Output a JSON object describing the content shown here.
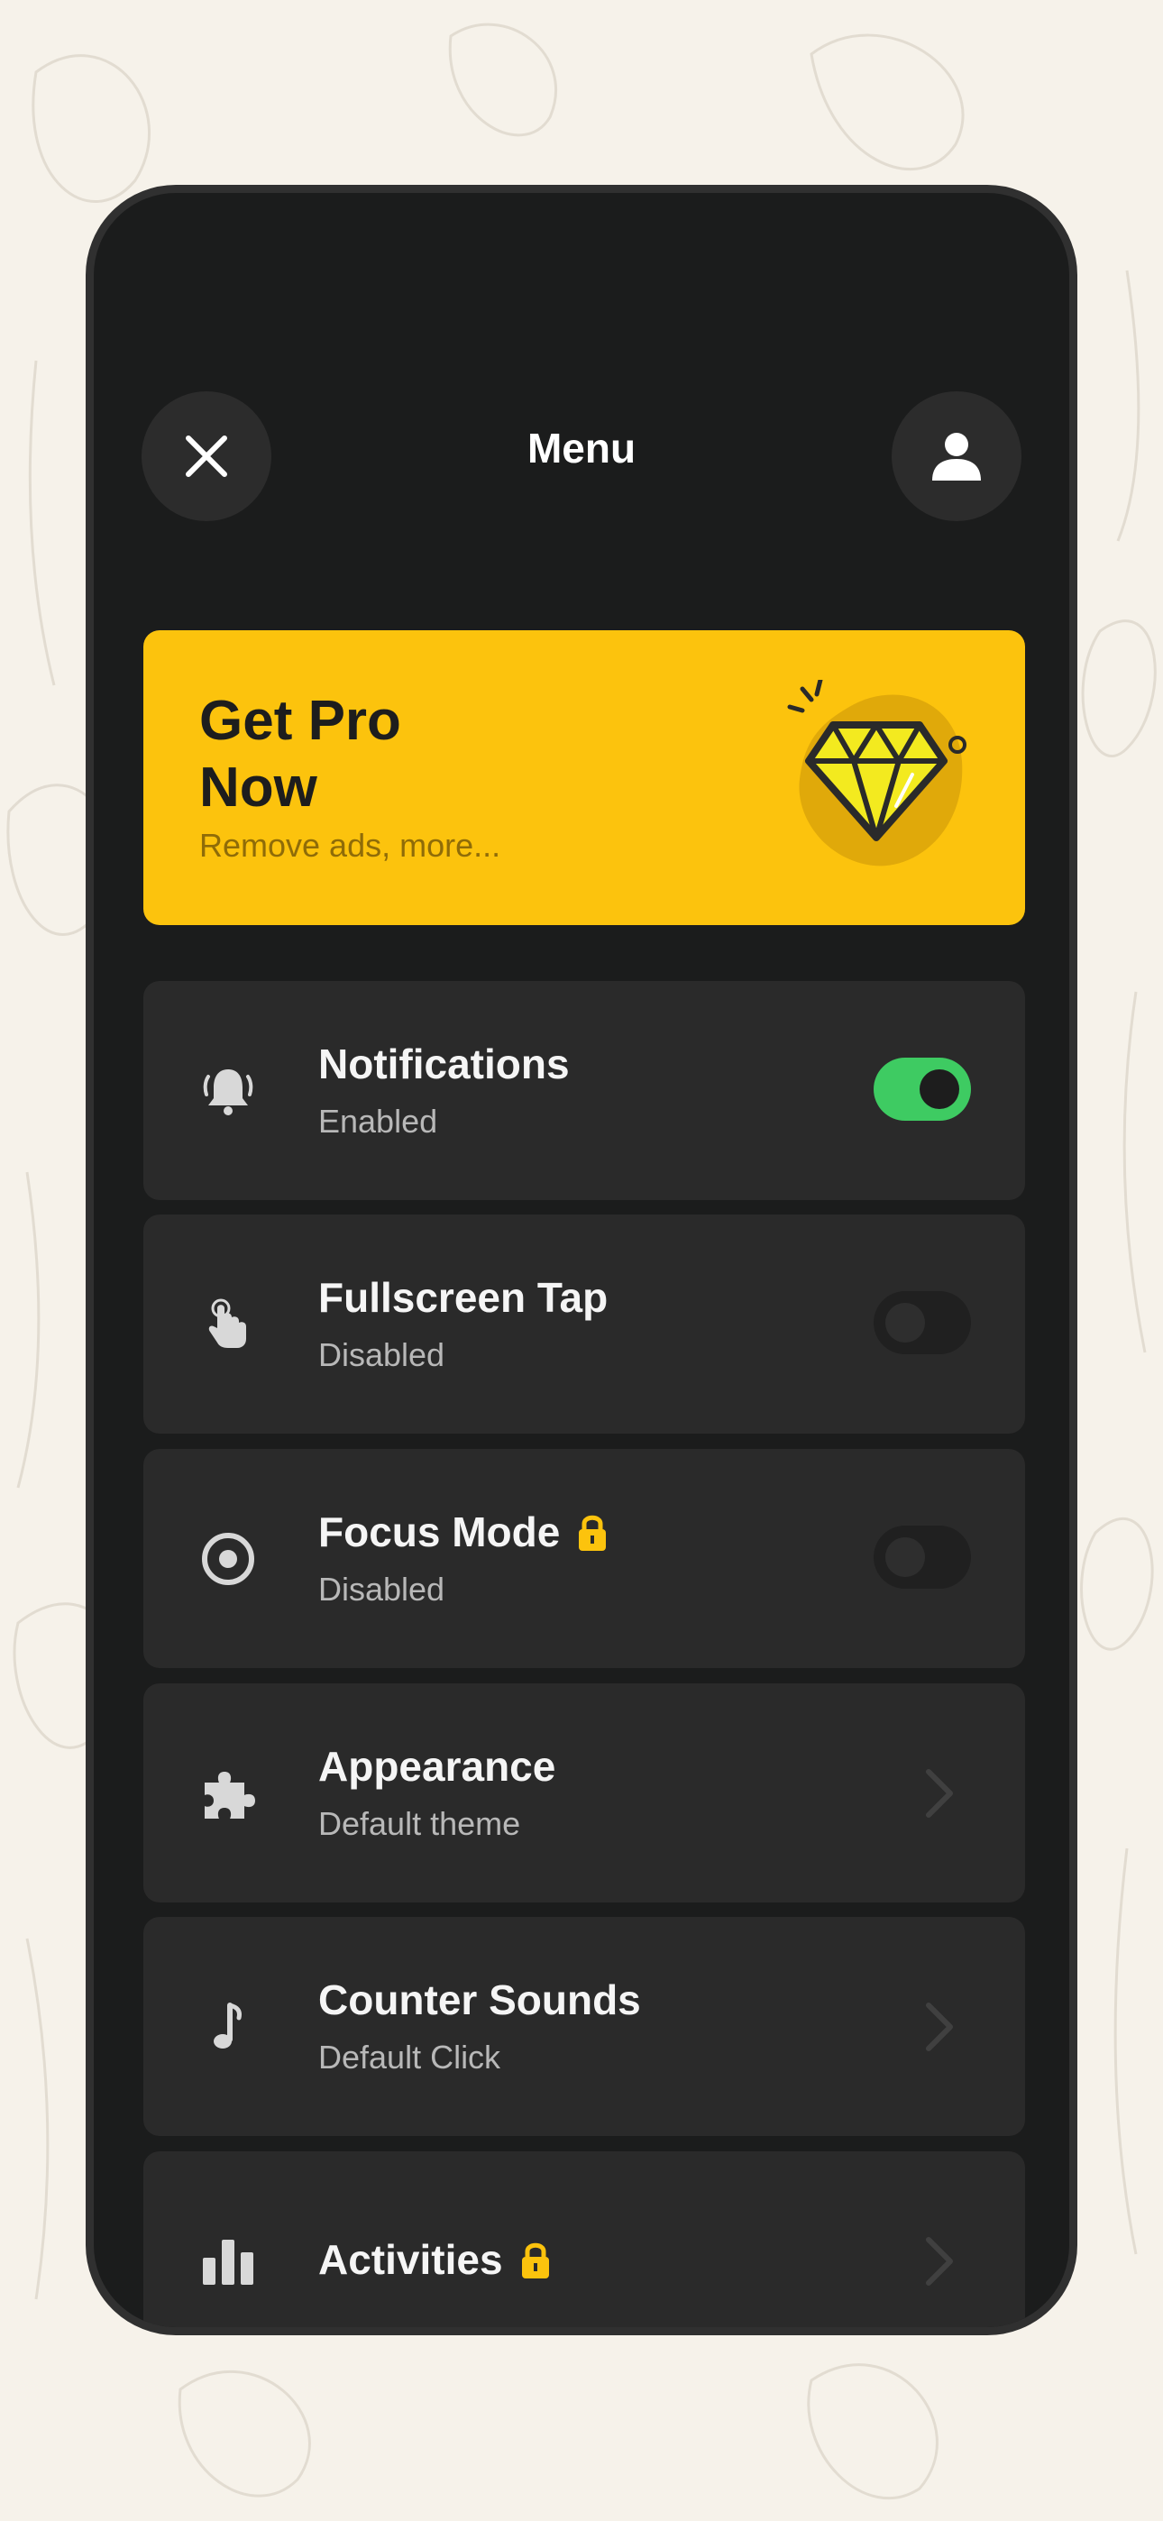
{
  "header": {
    "title": "Menu",
    "close_icon": "close-icon",
    "profile_icon": "user-icon"
  },
  "promo": {
    "title": "Get Pro Now",
    "subtitle": "Remove ads, more...",
    "icon": "diamond-icon",
    "color": "#fcc30d"
  },
  "items": [
    {
      "icon": "bell-icon",
      "title": "Notifications",
      "subtitle": "Enabled",
      "control": "toggle",
      "toggle_on": true,
      "locked": false
    },
    {
      "icon": "tap-icon",
      "title": "Fullscreen Tap",
      "subtitle": "Disabled",
      "control": "toggle",
      "toggle_on": false,
      "locked": false
    },
    {
      "icon": "target-icon",
      "title": "Focus Mode",
      "subtitle": "Disabled",
      "control": "toggle",
      "toggle_on": false,
      "locked": true
    },
    {
      "icon": "puzzle-icon",
      "title": "Appearance",
      "subtitle": "Default theme",
      "control": "chevron",
      "locked": false
    },
    {
      "icon": "music-note-icon",
      "title": "Counter Sounds",
      "subtitle": "Default Click",
      "control": "chevron",
      "locked": false
    },
    {
      "icon": "bar-chart-icon",
      "title": "Activities",
      "subtitle": "",
      "control": "chevron",
      "locked": true
    }
  ],
  "colors": {
    "accent": "#fcc30d",
    "toggle_on": "#3ecb62",
    "lock": "#fcc30d",
    "panel": "#1b1c1c",
    "card": "#2a2a2a"
  }
}
